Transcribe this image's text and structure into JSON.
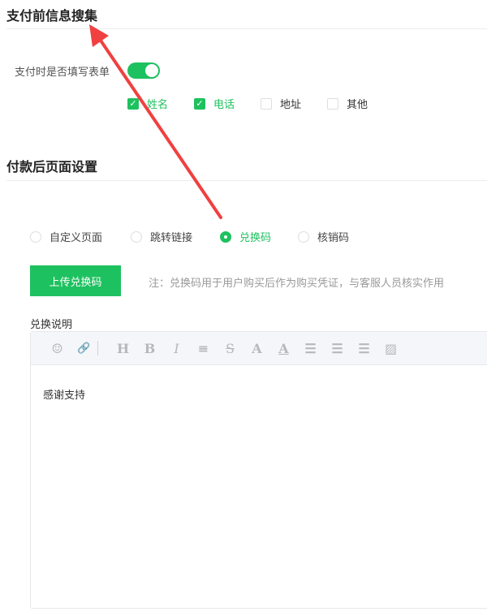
{
  "section1": {
    "title": "支付前信息搜集",
    "form_label": "支付时是否填写表单",
    "form_enabled": true,
    "fields": [
      {
        "label": "姓名",
        "checked": true
      },
      {
        "label": "电话",
        "checked": true
      },
      {
        "label": "地址",
        "checked": false
      },
      {
        "label": "其他",
        "checked": false
      }
    ]
  },
  "section2": {
    "title": "付款后页面设置",
    "options": [
      {
        "label": "自定义页面",
        "selected": false
      },
      {
        "label": "跳转链接",
        "selected": false
      },
      {
        "label": "兑换码",
        "selected": true
      },
      {
        "label": "核销码",
        "selected": false
      }
    ],
    "upload_button": "上传兑换码",
    "note": "注：兑换码用于用户购买后作为购买凭证，与客服人员核实作用",
    "editor_label": "兑换说明",
    "editor_content": "感谢支持",
    "toolbar": [
      "emoji-icon",
      "link-icon",
      "heading-icon",
      "bold-icon",
      "italic-icon",
      "align-icon",
      "strikethrough-icon",
      "font-color-icon",
      "background-color-icon",
      "ordered-list-icon",
      "unordered-list-icon",
      "indent-icon",
      "image-icon"
    ]
  },
  "accent": "#1ec15f",
  "annotation_color": "#f04040"
}
